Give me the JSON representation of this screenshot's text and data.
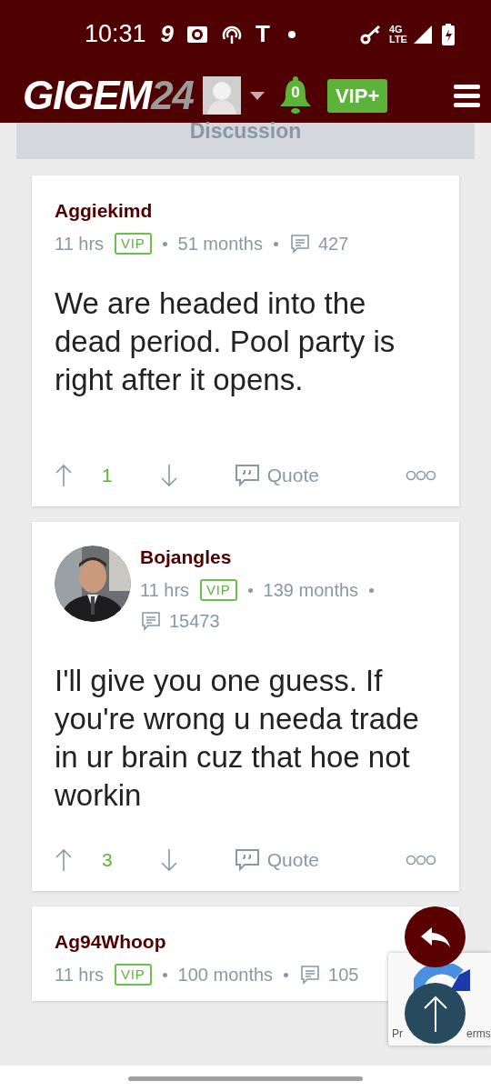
{
  "status_bar": {
    "time": "10:31",
    "notification_glyphs": [
      "9",
      "T"
    ],
    "network": "4G LTE"
  },
  "header": {
    "logo": {
      "main": "GIGEM",
      "accent": "24"
    },
    "notifications": "0",
    "vip_button": "VIP+"
  },
  "section_title": "Discussion",
  "posts": [
    {
      "author": "Aggiekimd",
      "has_avatar": false,
      "time": "11 hrs",
      "badge": "VIP",
      "tenure": "51 months",
      "post_count": "427",
      "body": "We are headed into the dead period. Pool party is right after it opens.",
      "votes": "1",
      "quote": "Quote"
    },
    {
      "author": "Bojangles",
      "has_avatar": true,
      "time": "11 hrs",
      "badge": "VIP",
      "tenure": "139 months",
      "post_count": "15473",
      "body": "I'll give you one guess. If you're wrong u needa trade in ur brain cuz that hoe not workin",
      "votes": "3",
      "quote": "Quote"
    },
    {
      "author": "Ag94Whoop",
      "has_avatar": false,
      "time": "11 hrs",
      "badge": "VIP",
      "tenure": "100 months",
      "post_count": "105"
    }
  ],
  "recaptcha": {
    "text_left": "Pr",
    "text_right": "erms"
  }
}
